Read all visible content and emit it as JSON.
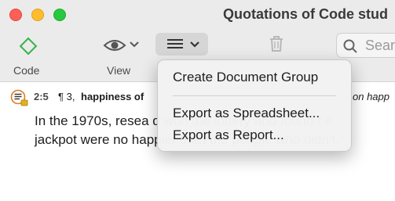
{
  "window": {
    "title": "Quotations of Code stud"
  },
  "toolbar": {
    "code_label": "Code",
    "view_label": "View",
    "search_placeholder": "Sear",
    "accent_color": "#35b34a"
  },
  "quotation": {
    "ref": "2:5",
    "paragraph": "¶ 3,",
    "code": "happiness of",
    "document": "on happ",
    "text": "In the 1970s, resea                d won the lottery and found t                e jackpot were no happier than the people who didn't."
  },
  "menu": {
    "items": [
      {
        "label": "Create Document Group"
      },
      {
        "label": "Export as Spreadsheet..."
      },
      {
        "label": "Export as Report..."
      }
    ]
  }
}
